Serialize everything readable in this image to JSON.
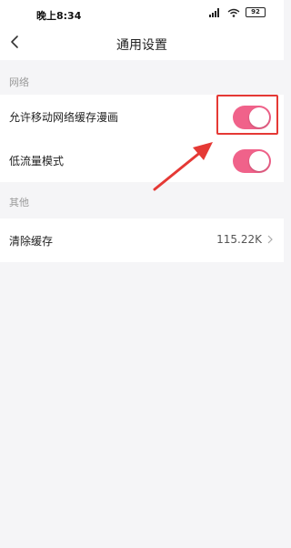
{
  "status_bar": {
    "time": "晚上8:34",
    "battery": "92",
    "icons": [
      "signal-icon",
      "wifi-icon",
      "battery-icon"
    ]
  },
  "nav": {
    "title": "通用设置",
    "back_icon": "back-arrow-icon"
  },
  "sections": [
    {
      "label": "网络",
      "items": [
        {
          "label": "允许移动网络缓存漫画",
          "control": "toggle",
          "on": true,
          "highlighted": true
        },
        {
          "label": "低流量模式",
          "control": "toggle",
          "on": true
        }
      ]
    },
    {
      "label": "其他",
      "items": [
        {
          "label": "清除缓存",
          "value": "115.22K",
          "control": "chevron"
        }
      ]
    }
  ],
  "colors": {
    "toggle_on": "#f0628a",
    "highlight": "#e53935",
    "background": "#f5f5f7"
  }
}
